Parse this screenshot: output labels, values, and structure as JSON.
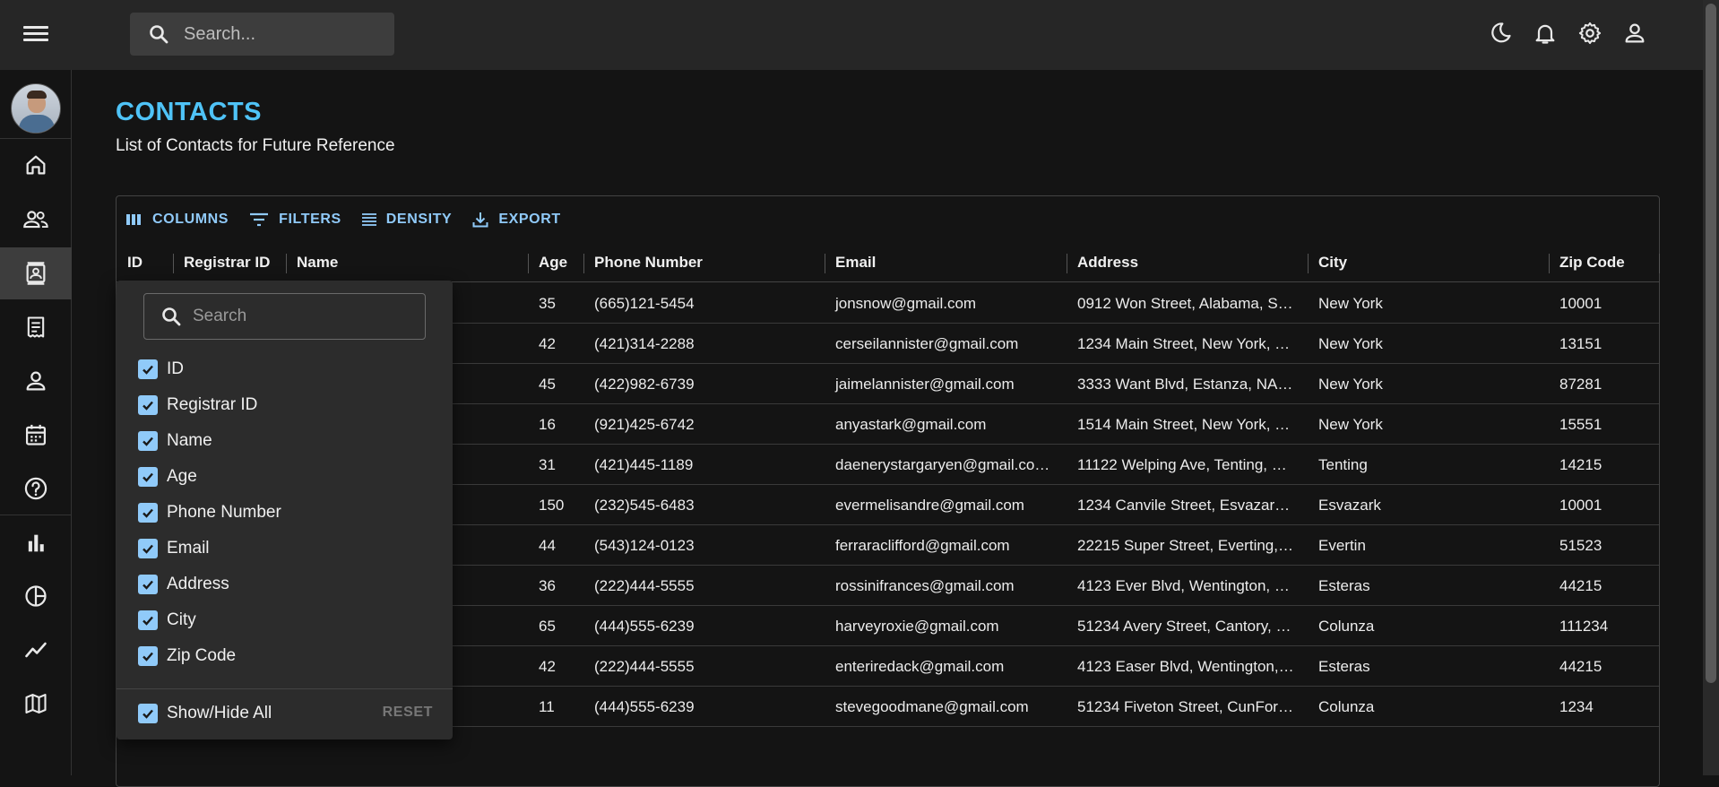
{
  "topbar": {
    "search_placeholder": "Search..."
  },
  "sidebar": {
    "items": [
      "home",
      "team",
      "contacts",
      "invoices",
      "profile",
      "calendar",
      "faq",
      "bar-chart",
      "pie-chart",
      "line-chart",
      "geography"
    ],
    "active": "contacts"
  },
  "page": {
    "title": "CONTACTS",
    "subtitle": "List of Contacts for Future Reference"
  },
  "toolbar": {
    "columns": "COLUMNS",
    "filters": "FILTERS",
    "density": "DENSITY",
    "export": "EXPORT"
  },
  "table": {
    "headers": [
      "ID",
      "Registrar ID",
      "Name",
      "Age",
      "Phone Number",
      "Email",
      "Address",
      "City",
      "Zip Code"
    ],
    "rows": [
      {
        "age": "35",
        "phone": "(665)121-5454",
        "email": "jonsnow@gmail.com",
        "address": "0912 Won Street, Alabama, S…",
        "city": "New York",
        "zip": "10001"
      },
      {
        "age": "42",
        "phone": "(421)314-2288",
        "email": "cerseilannister@gmail.com",
        "address": "1234 Main Street, New York, …",
        "city": "New York",
        "zip": "13151"
      },
      {
        "age": "45",
        "phone": "(422)982-6739",
        "email": "jaimelannister@gmail.com",
        "address": "3333 Want Blvd, Estanza, NA…",
        "city": "New York",
        "zip": "87281"
      },
      {
        "age": "16",
        "phone": "(921)425-6742",
        "email": "anyastark@gmail.com",
        "address": "1514 Main Street, New York, …",
        "city": "New York",
        "zip": "15551"
      },
      {
        "age": "31",
        "phone": "(421)445-1189",
        "email": "daenerystargaryen@gmail.co…",
        "address": "11122 Welping Ave, Tenting, …",
        "city": "Tenting",
        "zip": "14215"
      },
      {
        "age": "150",
        "phone": "(232)545-6483",
        "email": "evermelisandre@gmail.com",
        "address": "1234 Canvile Street, Esvazar…",
        "city": "Esvazark",
        "zip": "10001"
      },
      {
        "age": "44",
        "phone": "(543)124-0123",
        "email": "ferraraclifford@gmail.com",
        "address": "22215 Super Street, Everting,…",
        "city": "Evertin",
        "zip": "51523"
      },
      {
        "age": "36",
        "phone": "(222)444-5555",
        "email": "rossinifrances@gmail.com",
        "address": "4123 Ever Blvd, Wentington, …",
        "city": "Esteras",
        "zip": "44215"
      },
      {
        "age": "65",
        "phone": "(444)555-6239",
        "email": "harveyroxie@gmail.com",
        "address": "51234 Avery Street, Cantory, …",
        "city": "Colunza",
        "zip": "111234"
      },
      {
        "age": "42",
        "phone": "(222)444-5555",
        "email": "enteriredack@gmail.com",
        "address": "4123 Easer Blvd, Wentington,…",
        "city": "Esteras",
        "zip": "44215"
      },
      {
        "age": "11",
        "phone": "(444)555-6239",
        "email": "stevegoodmane@gmail.com",
        "address": "51234 Fiveton Street, CunFor…",
        "city": "Colunza",
        "zip": "1234"
      }
    ]
  },
  "columns_panel": {
    "search_placeholder": "Search",
    "columns": [
      "ID",
      "Registrar ID",
      "Name",
      "Age",
      "Phone Number",
      "Email",
      "Address",
      "City",
      "Zip Code"
    ],
    "show_hide_all": "Show/Hide All",
    "reset": "RESET"
  }
}
